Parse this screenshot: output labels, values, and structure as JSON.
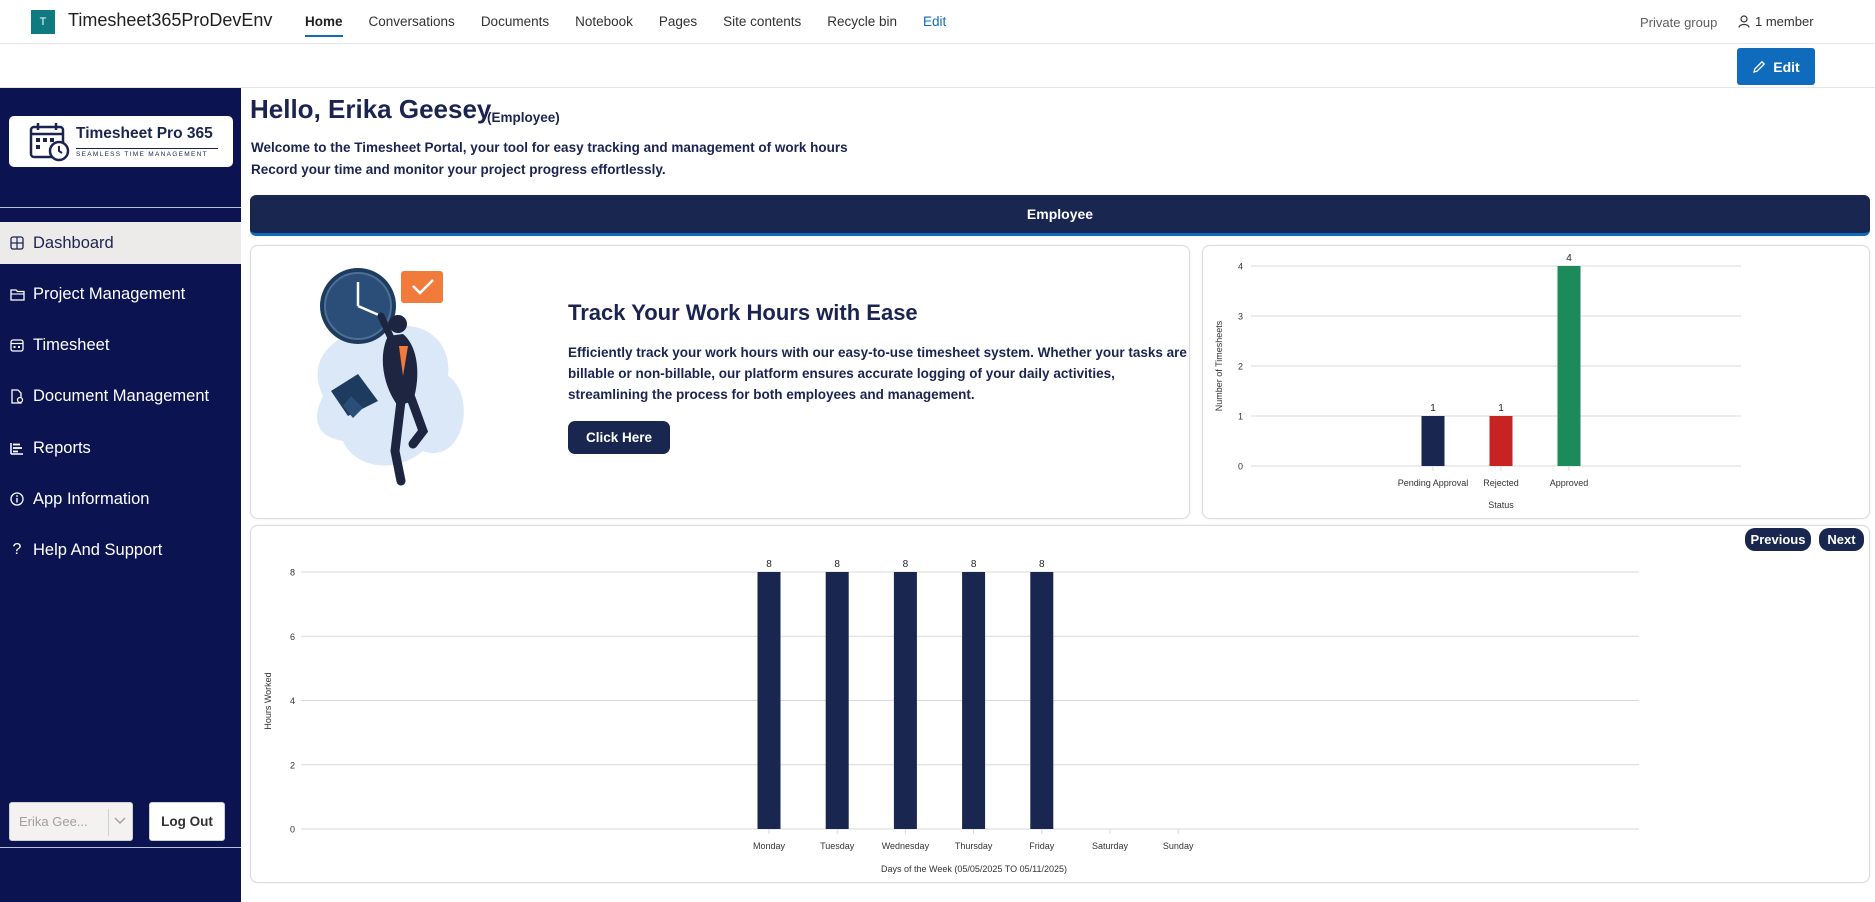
{
  "topbar": {
    "site_logo_letter": "T",
    "site_title": "Timesheet365ProDevEnv",
    "nav": [
      "Home",
      "Conversations",
      "Documents",
      "Notebook",
      "Pages",
      "Site contents",
      "Recycle bin",
      "Edit"
    ],
    "private_group": "Private group",
    "member_count": "1 member",
    "edit_button": "Edit"
  },
  "sidebar": {
    "brand_title": "Timesheet Pro 365",
    "brand_tagline": "SEAMLESS TIME MANAGEMENT",
    "items": [
      {
        "label": "Dashboard",
        "icon": "dashboard-icon",
        "active": true
      },
      {
        "label": "Project Management",
        "icon": "folder-icon",
        "active": false
      },
      {
        "label": "Timesheet",
        "icon": "calendar-icon",
        "active": false
      },
      {
        "label": "Document Management",
        "icon": "document-icon",
        "active": false
      },
      {
        "label": "Reports",
        "icon": "reports-icon",
        "active": false
      },
      {
        "label": "App Information",
        "icon": "info-icon",
        "active": false
      },
      {
        "label": "Help And Support",
        "icon": "question-icon",
        "active": false
      }
    ],
    "user_select_value": "Erika Gee...",
    "logout_label": "Log Out"
  },
  "main": {
    "hello": "Hello, Erika Geesey",
    "role": "(Employee)",
    "welcome_line1": "Welcome to the Timesheet Portal, your tool for easy tracking and management of work hours",
    "welcome_line2": "Record your time and monitor your project progress effortlessly.",
    "tab_label": "Employee",
    "track_title": "Track Your Work Hours with Ease",
    "track_text": "Efficiently track your work hours with our easy-to-use timesheet system. Whether your tasks are billable or non-billable, our platform ensures accurate logging of your daily activities, streamlining the process for both employees and management.",
    "click_button": "Click Here",
    "previous_button": "Previous",
    "next_button": "Next"
  },
  "colors": {
    "navy": "#182650",
    "sidebar": "#0b1451",
    "accent_blue": "#0f6cbd",
    "rejected_red": "#c82323",
    "approved_green": "#1c8a5a"
  },
  "chart_data": [
    {
      "type": "bar",
      "categories": [
        "Pending Approval",
        "Rejected",
        "Approved"
      ],
      "values": [
        1,
        1,
        4
      ],
      "colors": [
        "#182650",
        "#c82323",
        "#1c8a5a"
      ],
      "xlabel": "Status",
      "ylabel": "Number of Timesheets",
      "ylim": [
        0,
        4
      ],
      "yticks": [
        0,
        1,
        2,
        3,
        4
      ],
      "grid": true
    },
    {
      "type": "bar",
      "categories": [
        "Monday",
        "Tuesday",
        "Wednesday",
        "Thursday",
        "Friday",
        "Saturday",
        "Sunday"
      ],
      "values": [
        8,
        8,
        8,
        8,
        8,
        0,
        0
      ],
      "labels": [
        "8",
        "8",
        "8",
        "8",
        "8",
        "",
        ""
      ],
      "xlabel": "Days of the Week (05/05/2025 TO 05/11/2025)",
      "ylabel": "Hours Worked",
      "ylim": [
        0,
        8
      ],
      "yticks": [
        0,
        2,
        4,
        6,
        8
      ],
      "grid": true
    }
  ]
}
